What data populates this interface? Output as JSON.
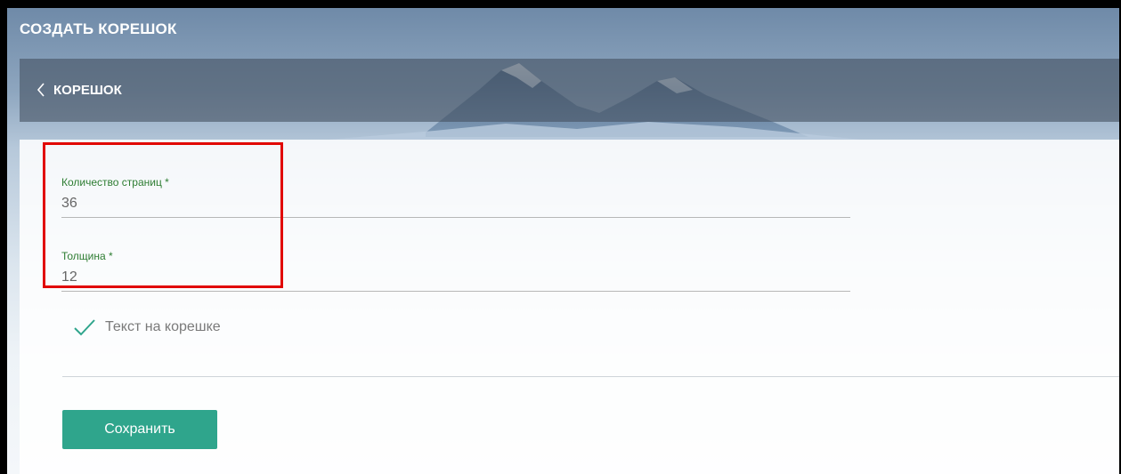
{
  "header": {
    "title": "СОЗДАТЬ КОРЕШОК"
  },
  "breadcrumb": {
    "back_icon": "chevron-left-icon",
    "label": "КОРЕШОК"
  },
  "form": {
    "pages_field": {
      "label": "Количество страниц *",
      "value": "36"
    },
    "thickness_field": {
      "label": "Толщина *",
      "value": "12"
    },
    "spine_text_checkbox": {
      "label": "Текст на корешке",
      "checked": true,
      "icon": "checkmark-icon"
    },
    "save_label": "Сохранить"
  },
  "colors": {
    "accent": "#2fa58c",
    "label_green": "#2e7d32",
    "highlight_red": "#e10600"
  }
}
